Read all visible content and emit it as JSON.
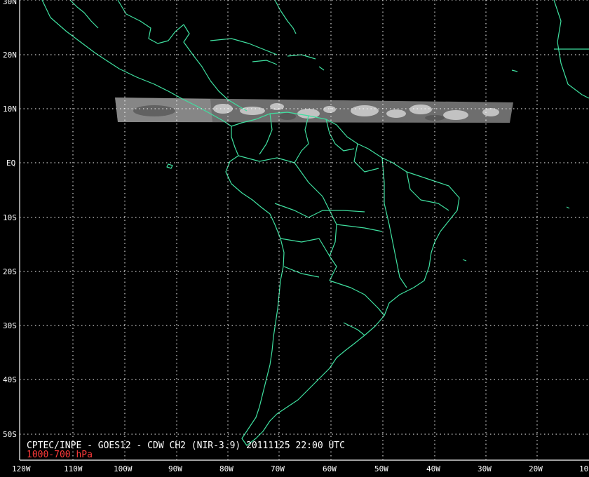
{
  "map": {
    "caption": "CPTEC/INPE - GOES12 - CDW CH2 (NIR-3.9) 20111125 22:00 UTC",
    "level_label": "1000-700 hPa",
    "colors": {
      "background": "#000000",
      "coastline": "#3fe0a0",
      "grid": "#ffffff",
      "frame": "#ffffff",
      "text": "#ffffff",
      "level_text": "#ff3a3a",
      "swath": "#8c8c8c"
    },
    "lat_labels": [
      "30N",
      "20N",
      "10N",
      "EQ",
      "10S",
      "20S",
      "30S",
      "40S",
      "50S"
    ],
    "lon_labels": [
      "120W",
      "110W",
      "100W",
      "90W",
      "80W",
      "70W",
      "60W",
      "50W",
      "40W",
      "30W",
      "20W",
      "10"
    ],
    "grid": "dotted",
    "extent": {
      "lon": [
        -120,
        -10
      ],
      "lat": [
        -55,
        30
      ]
    }
  }
}
